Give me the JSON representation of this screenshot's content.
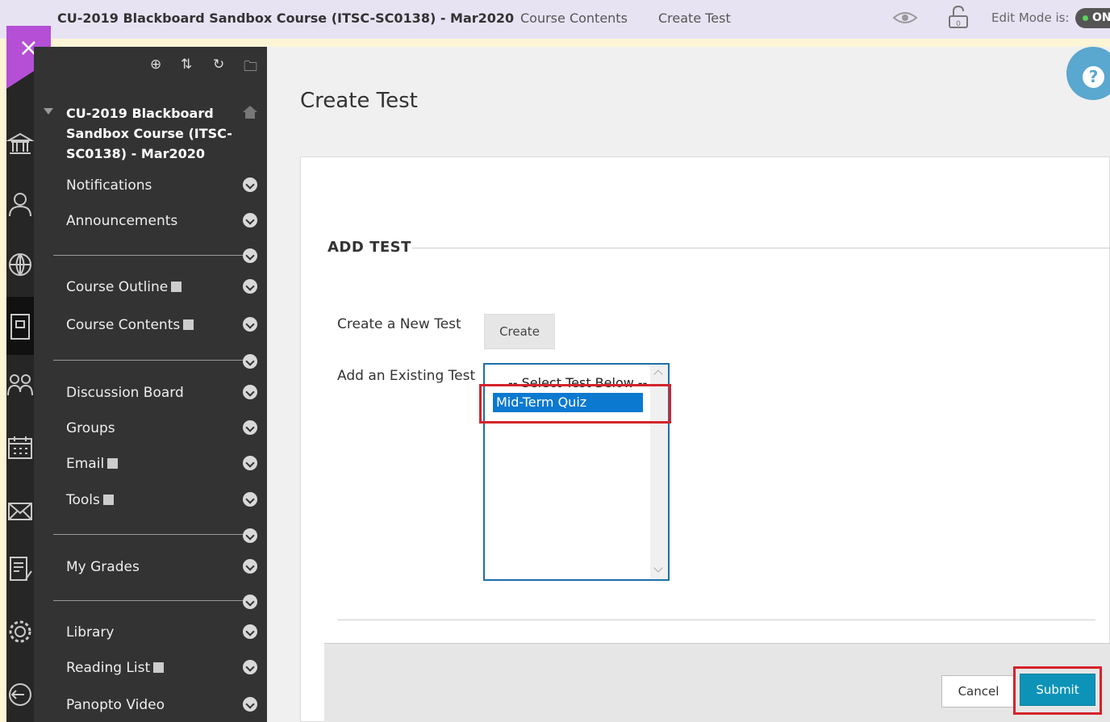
{
  "topbar": {
    "course_title": "CU-2019 Blackboard Sandbox Course (ITSC-SC0138) - Mar2020",
    "breadcrumbs": [
      "Course Contents",
      "Create Test"
    ],
    "edit_mode_label": "Edit Mode is:",
    "edit_mode_value": "ON"
  },
  "close_button": {
    "icon": "close-icon",
    "glyph": "×"
  },
  "icon_strip": [
    "institution-icon",
    "profile-icon",
    "globe-icon",
    "courses-icon",
    "groups-icon",
    "calendar-icon",
    "messages-icon",
    "grades-icon",
    "tools-icon",
    "sign-out-icon"
  ],
  "course_menu": {
    "toolbar": [
      "⊕",
      "⇅",
      "↻",
      "🗀"
    ],
    "course_name": "CU-2019 Blackboard Sandbox Course (ITSC-SC0138) - Mar2020",
    "items": [
      {
        "label": "Notifications",
        "ext": false
      },
      {
        "label": "Announcements",
        "ext": false
      },
      {
        "label": "Course Outline",
        "ext": true
      },
      {
        "label": "Course Contents",
        "ext": true
      },
      {
        "label": "Discussion Board",
        "ext": false
      },
      {
        "label": "Groups",
        "ext": false
      },
      {
        "label": "Email",
        "ext": true
      },
      {
        "label": "Tools",
        "ext": true
      },
      {
        "label": "My Grades",
        "ext": false
      },
      {
        "label": "Library",
        "ext": false
      },
      {
        "label": "Reading List",
        "ext": true
      },
      {
        "label": "Panopto Video",
        "ext": false
      }
    ]
  },
  "main": {
    "page_title": "Create Test",
    "help_glyph": "?",
    "section_title": "ADD TEST",
    "create_label": "Create a New Test",
    "create_button": "Create",
    "existing_label": "Add an Existing Test",
    "test_list_header": "-- Select Test Below --",
    "test_options": [
      "Mid-Term Quiz"
    ],
    "cancel_button": "Cancel",
    "submit_button": "Submit"
  },
  "colors": {
    "accent_purple": "#b44fd6",
    "submit_blue": "#0d93b8",
    "highlight_red": "#d4242a",
    "selected_blue": "#0b79d0"
  }
}
